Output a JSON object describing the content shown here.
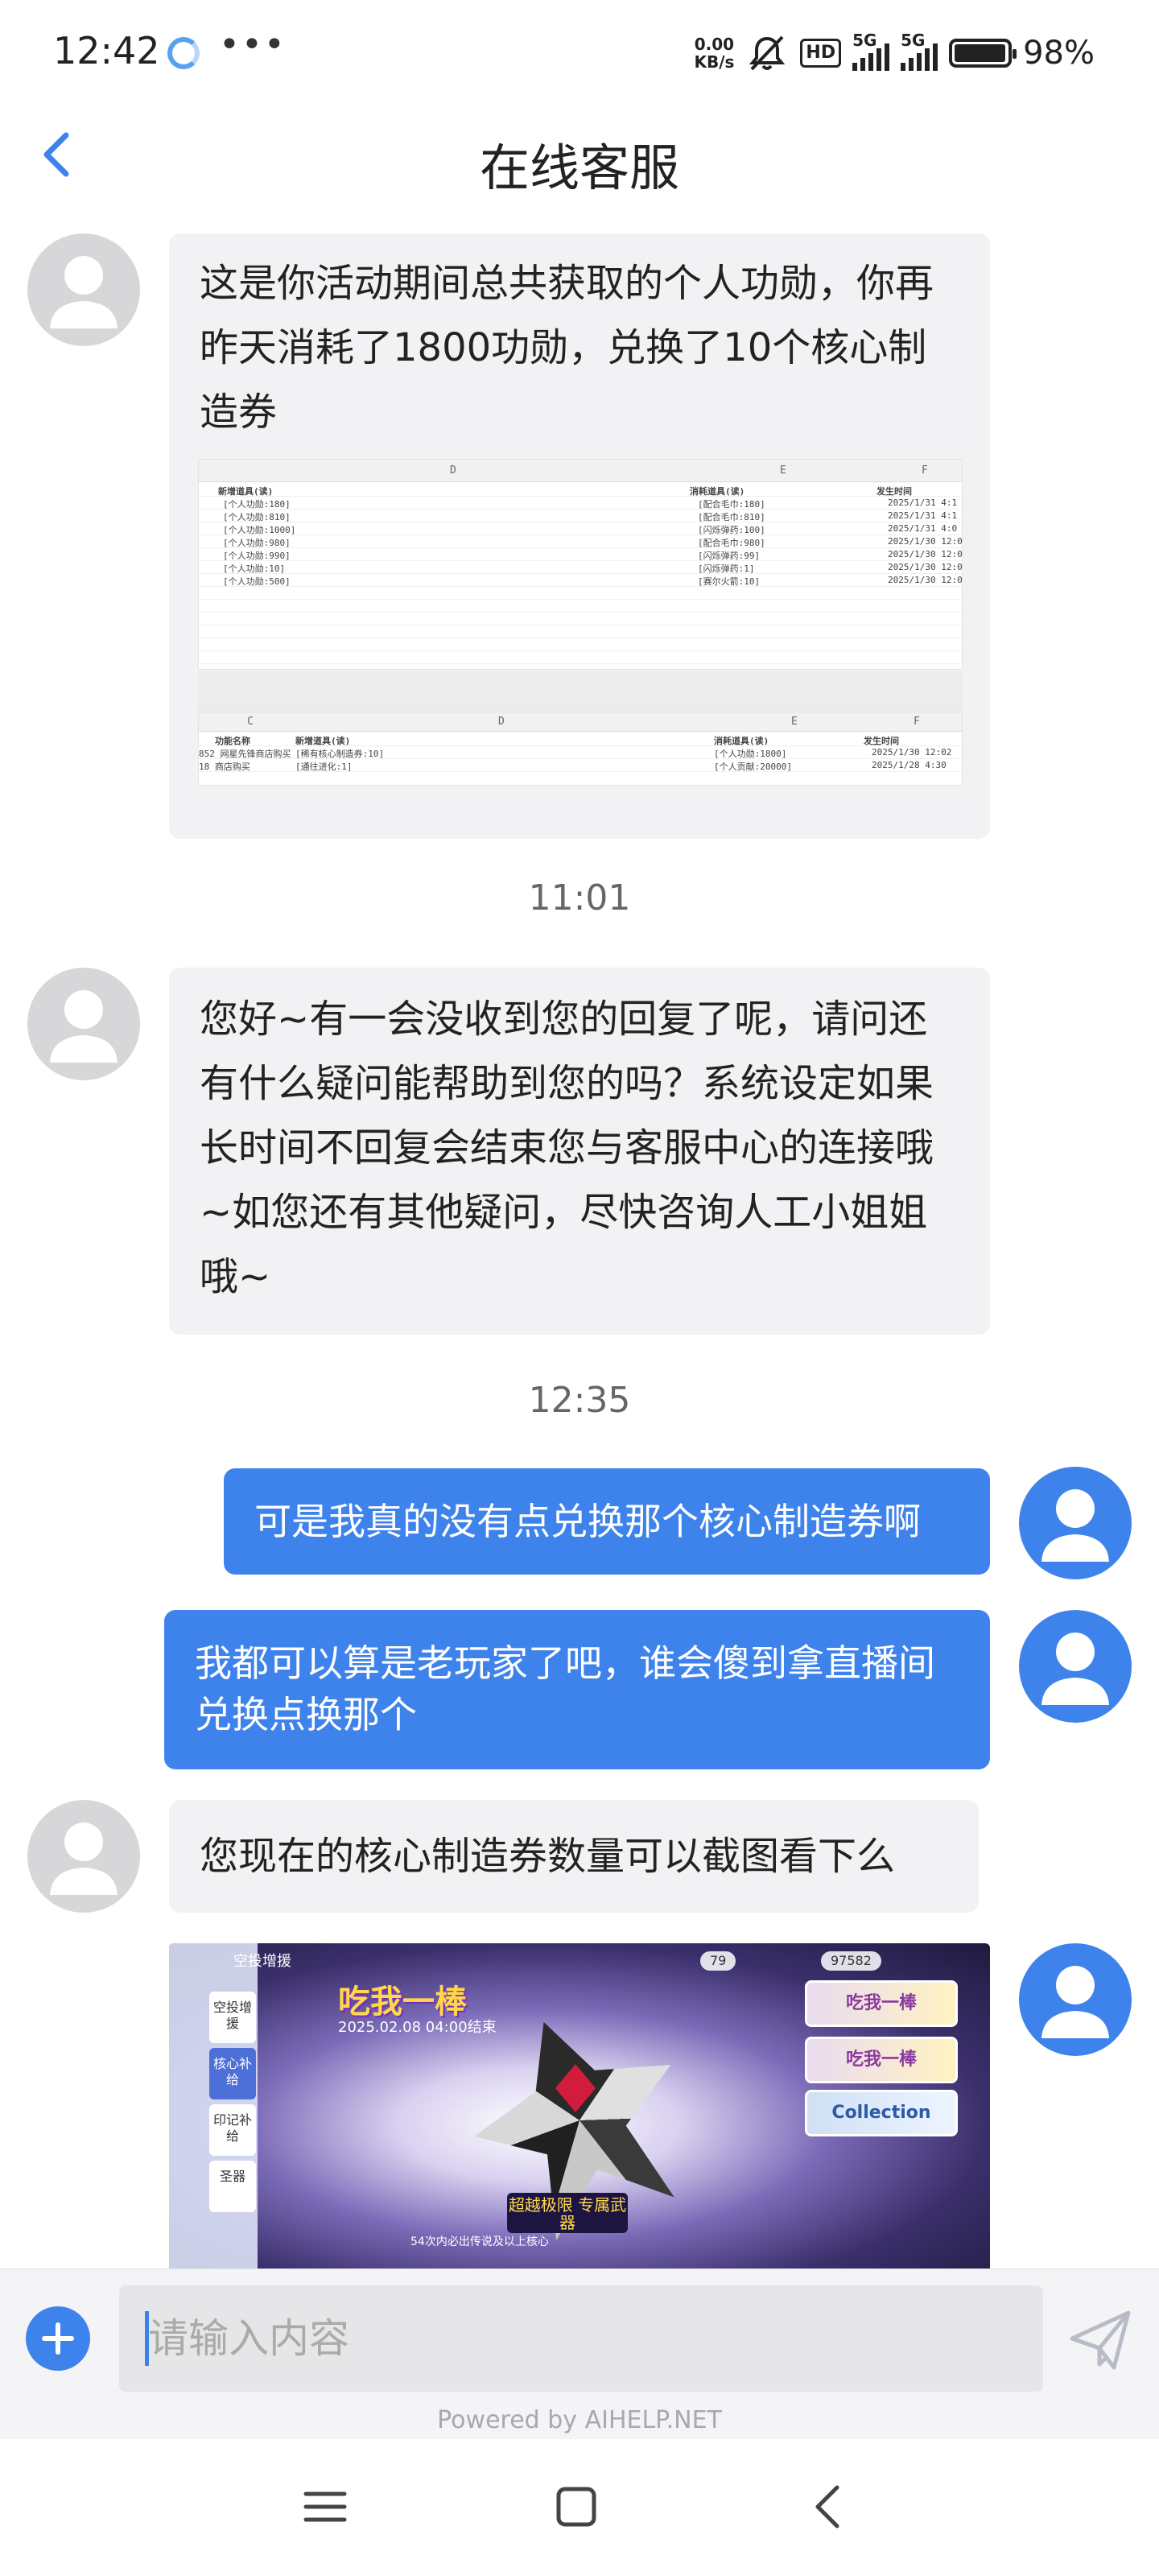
{
  "status_bar": {
    "time": "12:42",
    "net_speed_value": "0.00",
    "net_speed_unit": "KB/s",
    "hd_label": "HD",
    "signal1_label": "5G",
    "signal2_label": "5G",
    "battery_percent": "98%",
    "battery_level": 0.98,
    "more_label": "•••"
  },
  "header": {
    "title": "在线客服"
  },
  "messages": {
    "m1_text": "这是你活动期间总共获取的个人功勋，你再昨天消耗了1800功勋，兑换了10个核心制造券",
    "ts1": "11:01",
    "m2_text": "您好~有一会没收到您的回复了呢，请问还有什么疑问能帮助到您的吗？系统设定如果长时间不回复会结束您与客服中心的连接哦~如您还有其他疑问，尽快咨询人工小姐姐哦~",
    "ts2": "12:35",
    "u1_text": "可是我真的没有点兑换那个核心制造券啊",
    "u2_text": "我都可以算是老玩家了吧，谁会傻到拿直播间兑换点换那个",
    "m3_text": "您现在的核心制造券数量可以截图看下么"
  },
  "sheet1": {
    "col_d": "D",
    "col_e": "E",
    "col_f": "F",
    "h_add": "新增道具(读)",
    "h_cost": "消耗道具(读)",
    "h_time": "发生时间",
    "rows": [
      {
        "add": "[个人功勋:180]",
        "cost": "[配合毛巾:180]",
        "time": "2025/1/31  4:1"
      },
      {
        "add": "[个人功勋:810]",
        "cost": "[配合毛巾:810]",
        "time": "2025/1/31  4:1"
      },
      {
        "add": "[个人功勋:1000]",
        "cost": "[闪烁弹药:100]",
        "time": "2025/1/31  4:0"
      },
      {
        "add": "[个人功勋:980]",
        "cost": "[配合毛巾:980]",
        "time": "2025/1/30  12:0"
      },
      {
        "add": "[个人功勋:990]",
        "cost": "[闪烁弹药:99]",
        "time": "2025/1/30  12:0"
      },
      {
        "add": "[个人功勋:10]",
        "cost": "[闪烁弹药:1]",
        "time": "2025/1/30  12:0"
      },
      {
        "add": "[个人功勋:500]",
        "cost": "[赛尔火箭:10]",
        "time": "2025/1/30  12:0"
      }
    ]
  },
  "sheet2": {
    "col_c": "C",
    "col_d": "D",
    "col_e": "E",
    "col_f": "F",
    "h_func": "功能名称",
    "h_add": "新增道具(读)",
    "h_cost": "消耗道具(读)",
    "h_time": "发生时间",
    "rows": [
      {
        "func": "852 网星先锋商店购买",
        "add": "[稀有核心制造券:10]",
        "cost": "[个人功勋:1800]",
        "time": "2025/1/30 12:02"
      },
      {
        "func": "18 商店购买",
        "add": "[通往进化:1]",
        "cost": "[个人贡献:20000]",
        "time": "2025/1/28 4:30"
      }
    ]
  },
  "game": {
    "nav_title": "空投增援",
    "tab1": "空投增援",
    "tab2": "核心补给",
    "tab3": "印记补给",
    "tab4": "圣器",
    "headline": "吃我一棒",
    "date": "2025.02.08 04:00结束",
    "currency1": "79",
    "currency2": "97582",
    "banner1": "吃我一棒",
    "banner2": "吃我一棒",
    "banner3": "Collection",
    "badge": "超越极限 专属武器",
    "bottom_text": "54次内必出传说及以上核心"
  },
  "input": {
    "placeholder": "请输入内容",
    "powered_by": "Powered by AIHELP.NET"
  },
  "colors": {
    "accent": "#3e83ec",
    "agent_bubble": "#f2f2f4",
    "user_bubble": "#3e83ec",
    "timestamp": "#666666"
  },
  "icons": {
    "back": "chevron-left-icon",
    "plus": "plus-icon",
    "send": "send-icon",
    "nav_menu": "menu-icon",
    "nav_home": "home-icon",
    "nav_back": "back-icon"
  }
}
